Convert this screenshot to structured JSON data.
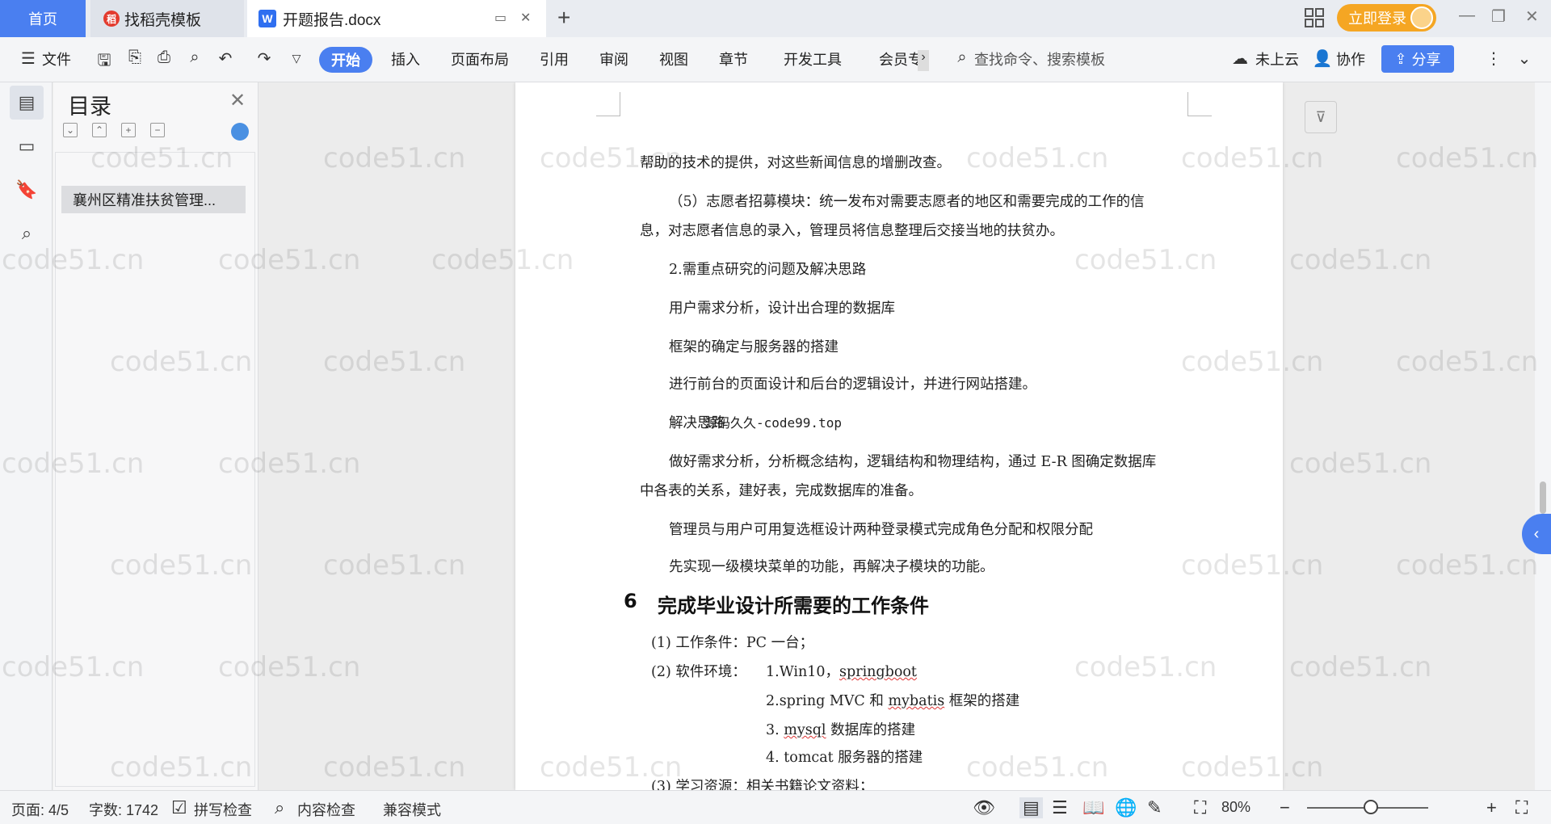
{
  "tabs": {
    "home": "首页",
    "daoke": "找稻壳模板",
    "doc": "开题报告.docx",
    "login": "立即登录"
  },
  "ribbon": {
    "file": "文件",
    "start": "开始",
    "insert": "插入",
    "layout": "页面布局",
    "reference": "引用",
    "review": "审阅",
    "view": "视图",
    "chapter": "章节",
    "devtools": "开发工具",
    "member": "会员专",
    "search_placeholder": "查找命令、搜索模板",
    "cloud": "未上云",
    "collab": "协作",
    "share": "分享"
  },
  "toc": {
    "title": "目录",
    "item1": "襄州区精准扶贫管理..."
  },
  "document": {
    "line1": "帮助的技术的提供，对这些新闻信息的增删改查。",
    "line2": "（5）志愿者招募模块：统一发布对需要志愿者的地区和需要完成的工作的信",
    "line3": "息，对志愿者信息的录入，管理员将信息整理后交接当地的扶贫办。",
    "line4": "2.需重点研究的问题及解决思路",
    "line5": "用户需求分析，设计出合理的数据库",
    "line6": "框架的确定与服务器的搭建",
    "line7": "进行前台的页面设计和后台的逻辑设计，并进行网站搭建。",
    "line8_a": "解决思路",
    "line8_b": "源码久久-code99.top",
    "line9": "做好需求分析，分析概念结构，逻辑结构和物理结构，通过 E-R 图确定数据库",
    "line10": "中各表的关系，建好表，完成数据库的准备。",
    "line11": "管理员与用户可用复选框设计两种登录模式完成角色分配和权限分配",
    "line12": "先实现一级模块菜单的功能，再解决子模块的功能。",
    "heading_num": "6",
    "heading": "完成毕业设计所需要的工作条件",
    "cond1": "(1)  工作条件：PC 一台；",
    "cond2_label": "(2)  软件环境：",
    "cond2_a": "1.Win10，",
    "cond2_a2": "springboot",
    "cond2_b1": "2.spring MVC 和 ",
    "cond2_b2": "mybatis",
    "cond2_b3": " 框架的搭建",
    "cond2_c1": "3. ",
    "cond2_c2": "mysql",
    "cond2_c3": " 数据库的搭建",
    "cond2_d": "4. tomcat 服务器的搭建",
    "cond3": "(3)  学习资源：相关书籍论文资料；"
  },
  "status": {
    "page": "页面: 4/5",
    "words": "字数: 1742",
    "spell": "拼写检查",
    "content_check": "内容检查",
    "compat": "兼容模式",
    "zoom": "80%"
  },
  "watermark": "code51.cn"
}
